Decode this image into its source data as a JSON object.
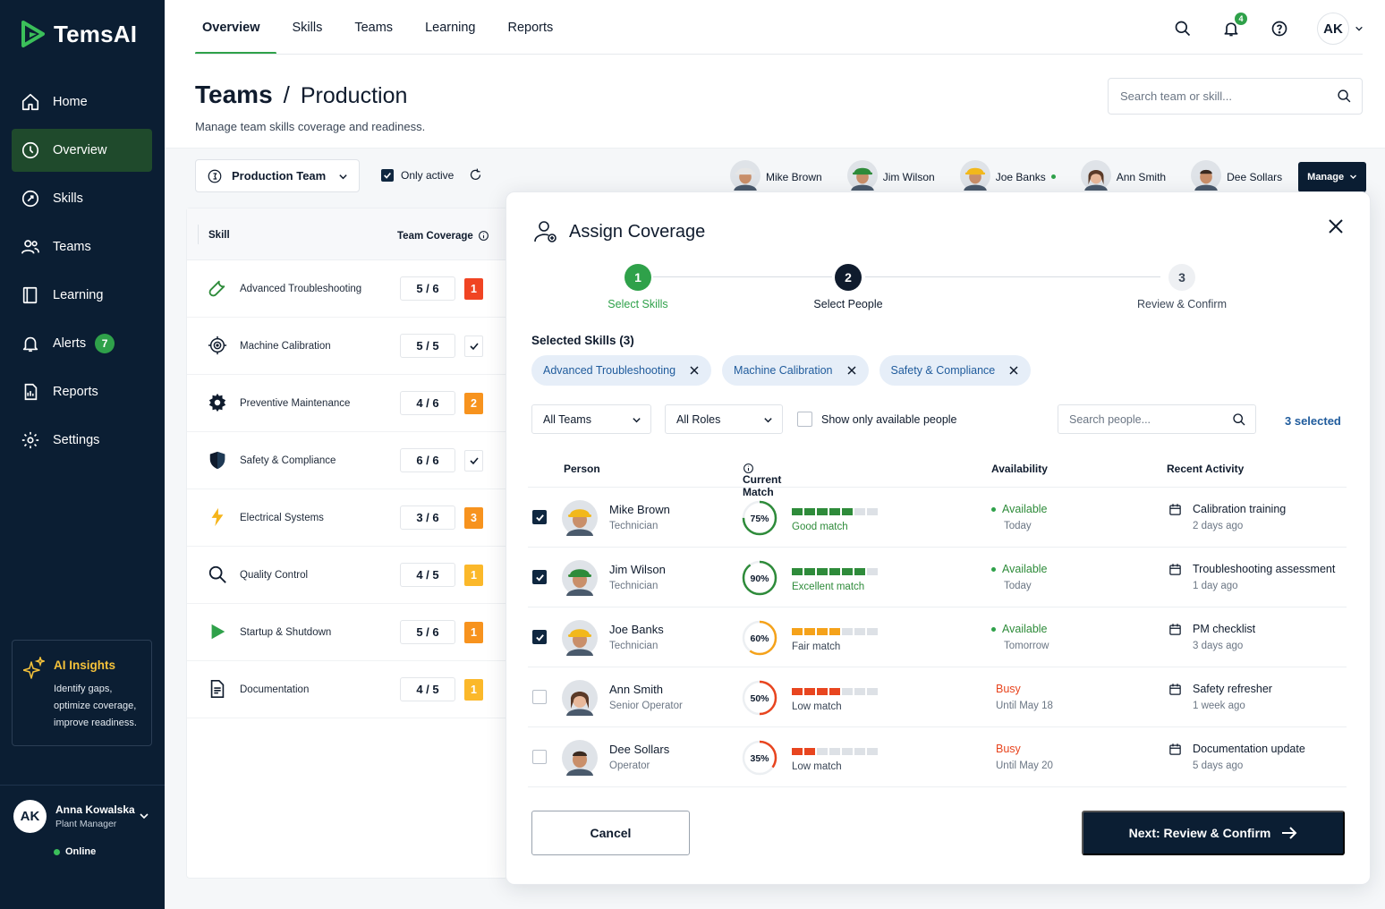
{
  "app": {
    "name": "TemsAI"
  },
  "sidebar": {
    "items": [
      {
        "label": "Home",
        "icon": "home-icon"
      },
      {
        "label": "Overview",
        "icon": "overview-icon",
        "active": true
      },
      {
        "label": "Skills",
        "icon": "skills-icon"
      },
      {
        "label": "Teams",
        "icon": "teams-icon"
      },
      {
        "label": "Learning",
        "icon": "learning-icon"
      },
      {
        "label": "Alerts",
        "icon": "bell-icon",
        "badge": "7"
      },
      {
        "label": "Reports",
        "icon": "reports-icon"
      },
      {
        "label": "Settings",
        "icon": "gear-icon"
      }
    ],
    "ai_insights": {
      "title": "AI Insights",
      "lines": [
        "Identify gaps,",
        "optimize coverage,",
        "improve readiness."
      ]
    },
    "user": {
      "initials": "AK",
      "name": "Anna Kowalska",
      "role": "Plant Manager",
      "status": "Online"
    }
  },
  "topnav": {
    "tabs": [
      "Overview",
      "Skills",
      "Teams",
      "Learning",
      "Reports"
    ],
    "active_tab": "Overview",
    "notifications": "4",
    "avatar_initials": "AK"
  },
  "header": {
    "title": "Teams",
    "separator": "/",
    "subtitle": "Production",
    "description": "Manage team skills coverage and readiness.",
    "search_placeholder": "Search team or skill..."
  },
  "toolbar": {
    "team": "Production Team",
    "only_active": "Only active",
    "manage": "Manage",
    "people": [
      "Mike Brown",
      "Jim Wilson",
      "Joe Banks",
      "Ann Smith",
      "Dee Sollars"
    ]
  },
  "skills_table": {
    "headers": {
      "skill": "Skill",
      "coverage": "Team Coverage"
    },
    "rows": [
      {
        "name": "Advanced Troubleshooting",
        "coverage": "5 / 6",
        "flag": "1",
        "level": "red"
      },
      {
        "name": "Machine Calibration",
        "coverage": "5 / 5",
        "flag": "",
        "level": "ok"
      },
      {
        "name": "Preventive Maintenance",
        "coverage": "4 / 6",
        "flag": "2",
        "level": "orange"
      },
      {
        "name": "Safety & Compliance",
        "coverage": "6 / 6",
        "flag": "",
        "level": "ok"
      },
      {
        "name": "Electrical Systems",
        "coverage": "3 / 6",
        "flag": "3",
        "level": "orange"
      },
      {
        "name": "Quality Control",
        "coverage": "4 / 5",
        "flag": "1",
        "level": "amber"
      },
      {
        "name": "Startup & Shutdown",
        "coverage": "5 / 6",
        "flag": "1",
        "level": "orange"
      },
      {
        "name": "Documentation",
        "coverage": "4 / 5",
        "flag": "1",
        "level": "amber"
      }
    ]
  },
  "modal": {
    "title": "Assign Coverage",
    "steps": [
      {
        "num": "1",
        "label": "Select Skills",
        "state": "done"
      },
      {
        "num": "2",
        "label": "Select People",
        "state": "current"
      },
      {
        "num": "3",
        "label": "Review & Confirm",
        "state": "next"
      }
    ],
    "selected_label": "Selected Skills (3)",
    "chips": [
      "Advanced Troubleshooting",
      "Machine Calibration",
      "Safety & Compliance"
    ],
    "filters": {
      "teams": "All Teams",
      "roles": "All Roles",
      "available_only": "Show only available people",
      "search_placeholder": "Search people...",
      "selected_count": "3 selected"
    },
    "headers": {
      "person": "Person",
      "match": "Current Match",
      "availability": "Availability",
      "activity": "Recent Activity"
    },
    "rows": [
      {
        "checked": true,
        "name": "Mike Brown",
        "role": "Technician",
        "match": 75,
        "match_label": "Good match",
        "availability": "Available",
        "when": "Today",
        "busy": false,
        "activity": "Calibration training",
        "activity_when": "2 days ago"
      },
      {
        "checked": true,
        "name": "Jim Wilson",
        "role": "Technician",
        "match": 90,
        "match_label": "Excellent match",
        "availability": "Available",
        "when": "Today",
        "busy": false,
        "activity": "Troubleshooting assessment",
        "activity_when": "1 day ago"
      },
      {
        "checked": true,
        "name": "Joe Banks",
        "role": "Technician",
        "match": 60,
        "match_label": "Fair match",
        "availability": "Available",
        "when": "Tomorrow",
        "busy": false,
        "activity": "PM checklist",
        "activity_when": "3 days ago"
      },
      {
        "checked": false,
        "name": "Ann Smith",
        "role": "Senior Operator",
        "match": 50,
        "match_label": "Low match",
        "availability": "Busy",
        "when": "Until May 18",
        "busy": true,
        "activity": "Safety refresher",
        "activity_when": "1 week ago"
      },
      {
        "checked": false,
        "name": "Dee Sollars",
        "role": "Operator",
        "match": 35,
        "match_label": "Low match",
        "availability": "Busy",
        "when": "Until May 20",
        "busy": true,
        "activity": "Documentation update",
        "activity_when": "5 days ago"
      }
    ],
    "cancel": "Cancel",
    "next": "Next: Review & Confirm"
  },
  "colors": {
    "brand_green": "#2fa14a",
    "navy": "#0b1e33",
    "chip_blue": "#1f5b9c",
    "busy_red": "#e8451f"
  }
}
